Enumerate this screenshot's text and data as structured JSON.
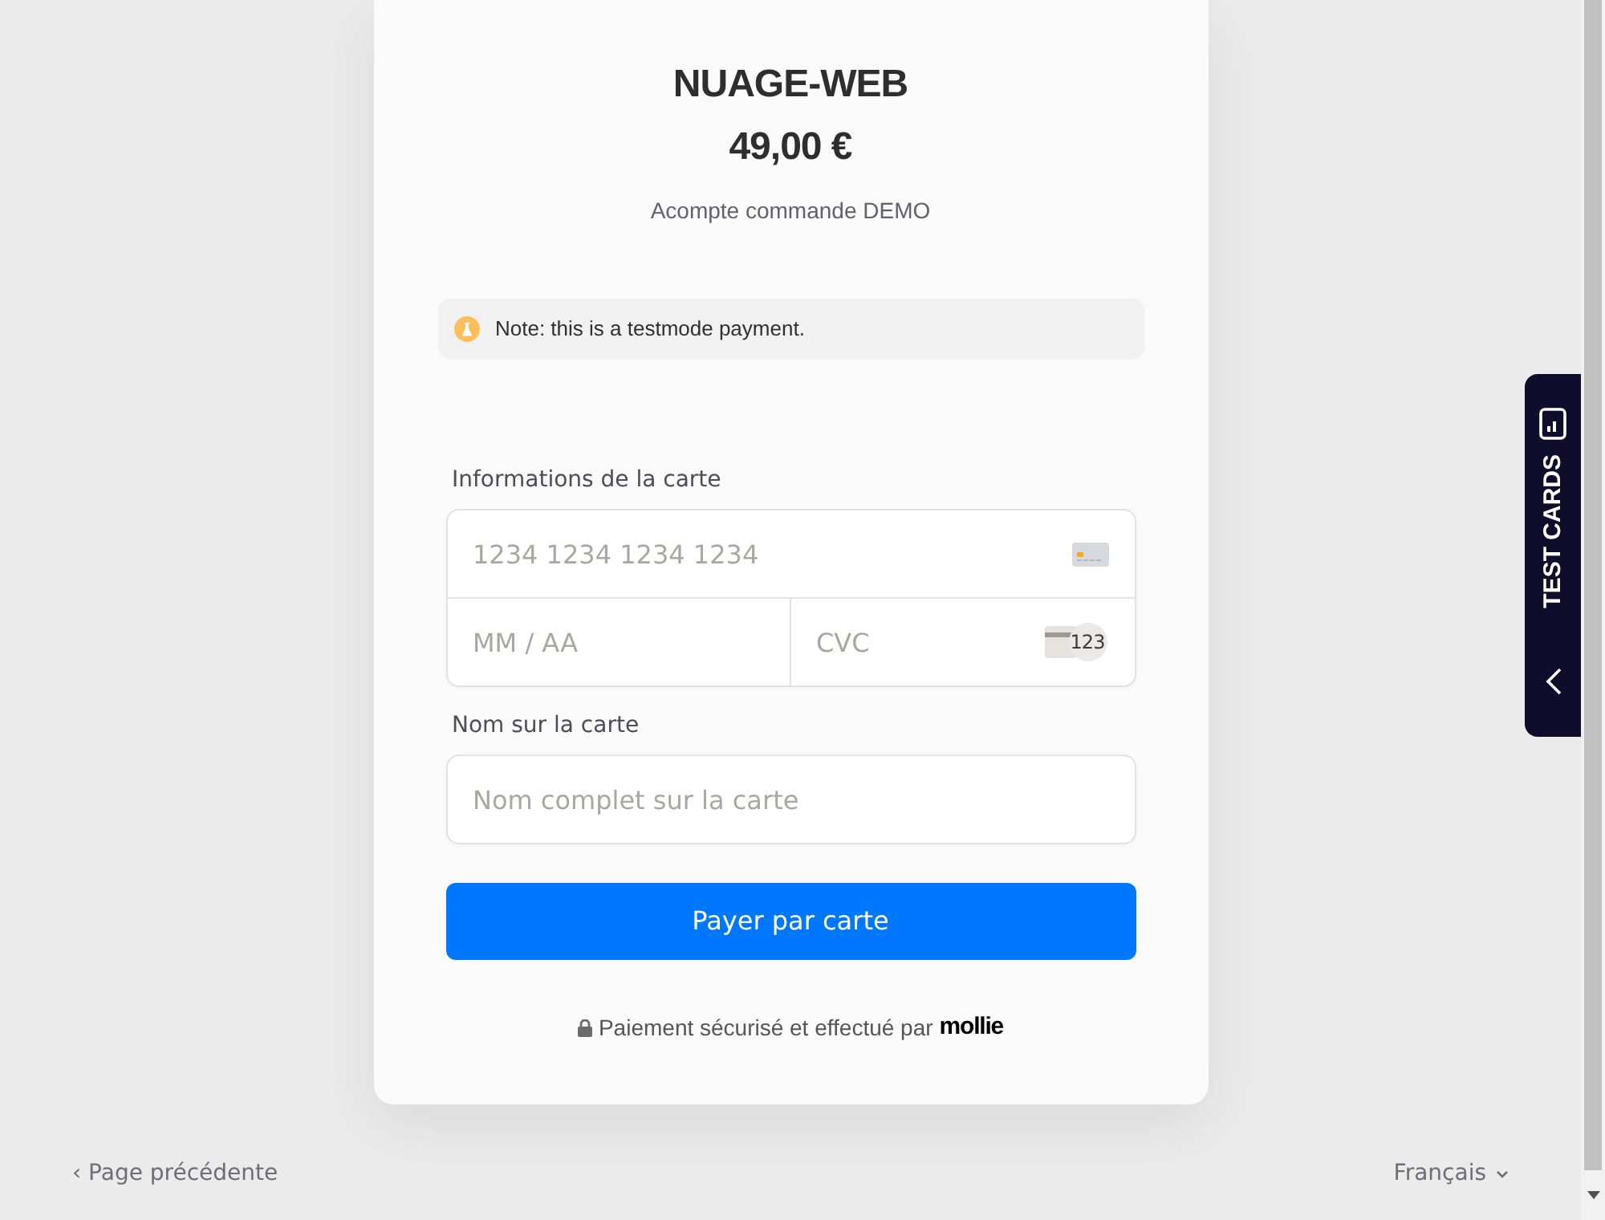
{
  "merchant": {
    "name": "NUAGE-WEB",
    "amount": "49,00 €",
    "description": "Acompte commande DEMO"
  },
  "notice": {
    "text": "Note: this is a testmode payment."
  },
  "card_form": {
    "card_section_label": "Informations de la carte",
    "card_number": {
      "placeholder": "1234 1234 1234 1234"
    },
    "expiry": {
      "placeholder": "MM / AA"
    },
    "cvc": {
      "placeholder": "CVC",
      "icon_text": "123"
    },
    "name_label": "Nom sur la carte",
    "name_field": {
      "placeholder": "Nom complet sur la carte"
    },
    "submit_button": "Payer par carte",
    "secure_note": "Paiement sécurisé et effectué par",
    "provider_logo": "mollie"
  },
  "footer": {
    "back_link": "‹ Page précédente",
    "language": "Français"
  },
  "test_cards_tab": {
    "label": "TEST CARDS"
  }
}
